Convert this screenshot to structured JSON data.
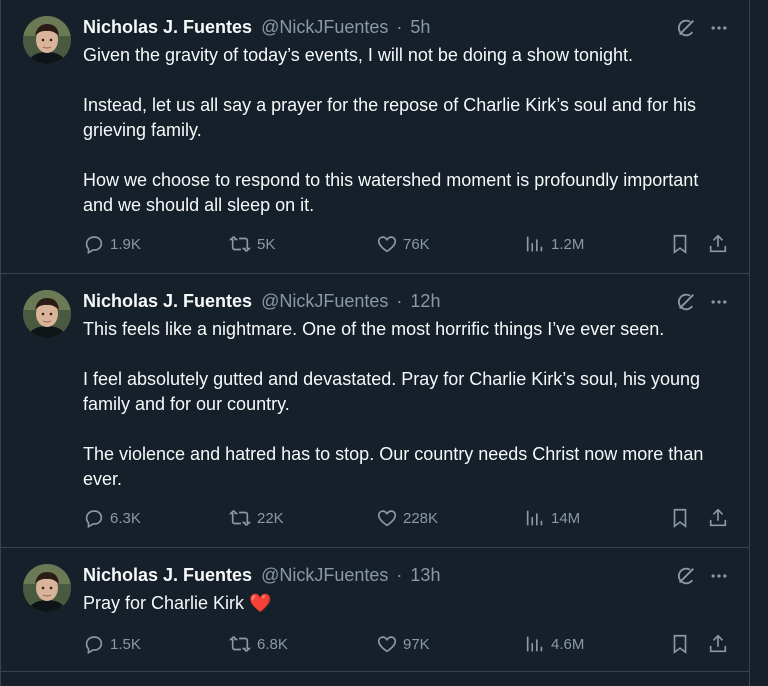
{
  "tweets": [
    {
      "author": {
        "name": "Nicholas J. Fuentes",
        "handle": "@NickJFuentes"
      },
      "separator": "·",
      "time": "5h",
      "paragraphs": [
        "Given the gravity of today’s events, I will not be doing a show tonight.",
        "Instead, let us all say a prayer for the repose of Charlie Kirk’s soul and for his grieving family.",
        "How we choose to respond to this watershed moment is profoundly important and we should all sleep on it."
      ],
      "stats": {
        "replies": "1.9K",
        "reposts": "5K",
        "likes": "76K",
        "views": "1.2M"
      }
    },
    {
      "author": {
        "name": "Nicholas J. Fuentes",
        "handle": "@NickJFuentes"
      },
      "separator": "·",
      "time": "12h",
      "paragraphs": [
        "This feels like a nightmare. One of the most horrific things I’ve ever seen.",
        "I feel absolutely gutted and devastated. Pray for Charlie Kirk’s soul, his young family and for our country.",
        "The violence and hatred has to stop. Our country needs Christ now more than ever."
      ],
      "stats": {
        "replies": "6.3K",
        "reposts": "22K",
        "likes": "228K",
        "views": "14M"
      }
    },
    {
      "author": {
        "name": "Nicholas J. Fuentes",
        "handle": "@NickJFuentes"
      },
      "separator": "·",
      "time": "13h",
      "paragraphs": [
        "Pray for Charlie Kirk"
      ],
      "emoji": "❤️",
      "stats": {
        "replies": "1.5K",
        "reposts": "6.8K",
        "likes": "97K",
        "views": "4.6M"
      }
    }
  ],
  "icons": {
    "grok": "grok-icon",
    "more": "more-icon",
    "reply": "reply-icon",
    "repost": "repost-icon",
    "like": "heart-icon",
    "views": "views-icon",
    "bookmark": "bookmark-icon",
    "share": "share-icon"
  },
  "colors": {
    "background": "#15202b",
    "border": "#38444d",
    "text": "#f7f9f9",
    "muted": "#8b98a5",
    "heart_emoji": "#e0245e"
  }
}
